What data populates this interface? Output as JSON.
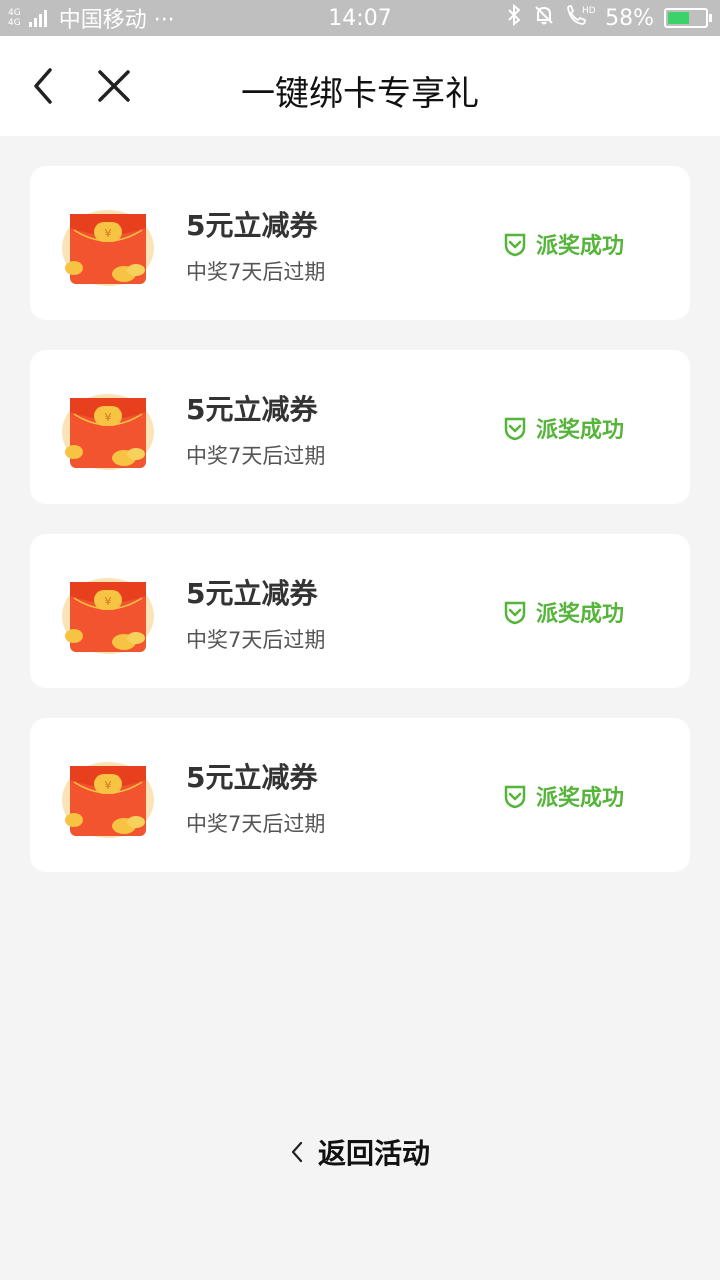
{
  "status_bar": {
    "network_top": "4G",
    "network_bottom": "4G",
    "carrier": "中国移动 ···",
    "time": "14:07",
    "battery": "58%",
    "battery_level": 0.58,
    "battery_color": "#3bd26a"
  },
  "nav": {
    "title": "一键绑卡专享礼"
  },
  "rewards": [
    {
      "title": "5元立减券",
      "subtitle": "中奖7天后过期",
      "status": "派奖成功"
    },
    {
      "title": "5元立减券",
      "subtitle": "中奖7天后过期",
      "status": "派奖成功"
    },
    {
      "title": "5元立减券",
      "subtitle": "中奖7天后过期",
      "status": "派奖成功"
    },
    {
      "title": "5元立减券",
      "subtitle": "中奖7天后过期",
      "status": "派奖成功"
    }
  ],
  "footer": {
    "back_label": "返回活动"
  },
  "colors": {
    "accent_green": "#55b53a",
    "envelope_red": "#f2542f",
    "coin_gold": "#f6c343"
  },
  "icons": [
    "back-arrow-icon",
    "close-icon",
    "red-envelope-icon",
    "shield-check-icon",
    "chevron-left-icon",
    "bluetooth-icon",
    "bell-off-icon",
    "hd-call-icon",
    "battery-icon"
  ]
}
